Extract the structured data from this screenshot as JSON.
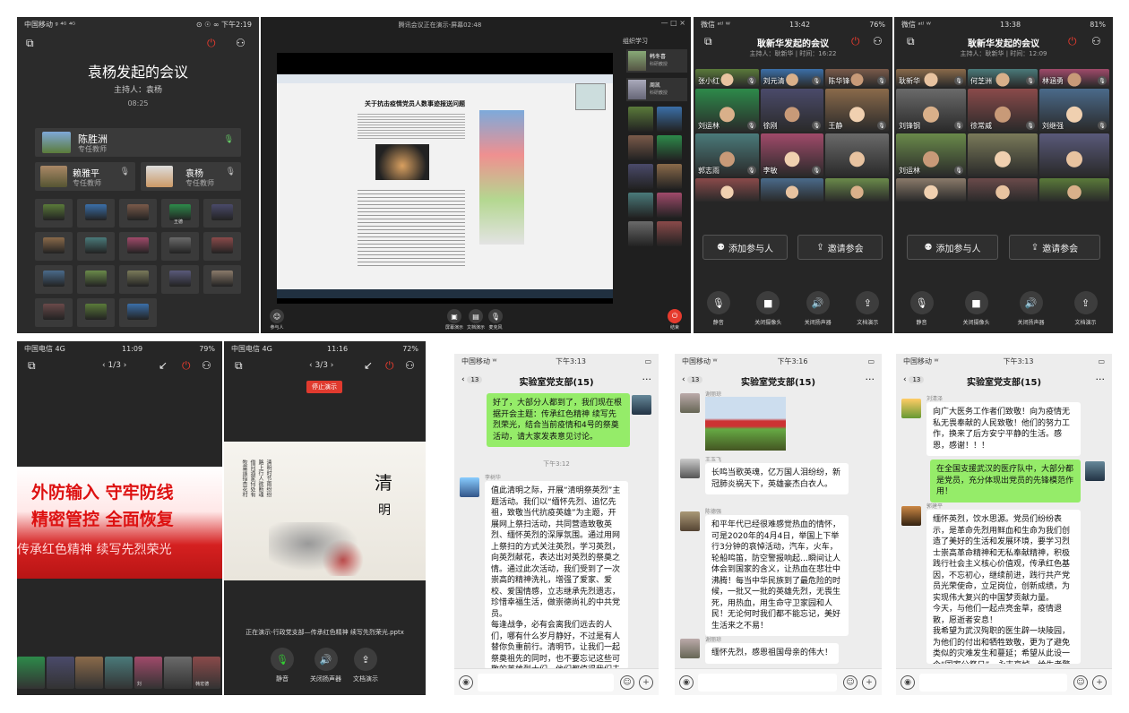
{
  "p1": {
    "status_left": "中国移动 ᵍ ⁴ᴳ ⁴ᴳ",
    "status_right": "⊙ ☉ ∞ 下午2:19",
    "title": "袁杨发起的会议",
    "host": "主持人：袁杨",
    "time": "08:25",
    "speakers": [
      {
        "name": "陈胜洲",
        "role": "专任教师"
      },
      {
        "name": "赖雅平",
        "role": "专任教师"
      },
      {
        "name": "袁杨",
        "role": "专任教师"
      }
    ],
    "grid_labels": [
      "",
      "",
      "",
      "王德",
      "",
      "",
      "",
      "",
      "",
      "",
      "",
      "",
      "",
      "",
      "",
      "",
      "",
      "",
      "",
      ""
    ]
  },
  "p2": {
    "title": "腾讯会议正在演示-屏幕02:48",
    "win_ctrls": "—  □  ×",
    "side_header": "组织学习",
    "side_users": [
      {
        "name": "韩冬喜",
        "role": "科研教授"
      },
      {
        "name": "周凯",
        "role": "科研教授"
      }
    ],
    "doc_title": "关于抗击疫情党员人数事迹报送问题",
    "bottom": [
      {
        "label": "参与人"
      },
      {
        "label": "屏幕演示"
      },
      {
        "label": "文档演示"
      },
      {
        "label": "麦克风"
      },
      {
        "label": "结束"
      }
    ]
  },
  "p3": {
    "status_left": "微信 ᵃᵗˡ ᵂ",
    "status_time": "13:42",
    "status_right": "76%",
    "title": "耿新华发起的会议",
    "sub": "主持人：耿新华 | 时间：16:22",
    "names": [
      "张小红",
      "刘元清",
      "陈华锋",
      "刘运林",
      "徐刚",
      "王静",
      "郭志雨",
      "李敏"
    ],
    "add": "添加参与人",
    "invite": "邀请参会",
    "tools": [
      "静音",
      "关闭摄像头",
      "关闭扬声器",
      "文档演示"
    ]
  },
  "p4": {
    "status_left": "微信 ᵃᵗˡ ᵂ",
    "status_time": "13:38",
    "status_right": "81%",
    "title": "耿新华发起的会议",
    "sub": "主持人：耿新华 | 时间：12:09",
    "names": [
      "耿新华",
      "何芝洲",
      "林涵勇",
      "刘锋钢",
      "徐常威",
      "刘继强",
      "刘运林"
    ],
    "add": "添加参与人",
    "invite": "邀请参会",
    "tools": [
      "静音",
      "关闭摄像头",
      "关闭扬声器",
      "文档演示"
    ]
  },
  "p5": {
    "status_left": "中国电信 4G",
    "status_time": "11:09",
    "status_right": "79%",
    "page": "‹ 1/3 ›",
    "banner1": "外防输入 守牢防线",
    "banner2": "精密管控 全面恢复",
    "banner3": "传承红色精神 续写先烈荣光",
    "thumb_labels": [
      "",
      "",
      "",
      "",
      "刘",
      "",
      "韩宏德"
    ]
  },
  "p6": {
    "status_left": "中国电信 4G",
    "status_time": "11:16",
    "status_right": "72%",
    "page": "‹ 3/3 ›",
    "stop": "停止演示",
    "qm1": "清",
    "qm2": "明",
    "poem": "清明时节雨纷纷\n路上行人欲断魂\n借问酒家何处有\n牧童遥指杏花村",
    "footer": "正在演示-行政党支部—传承红色精神 续写先烈荣光.pptx",
    "tools": [
      "静音",
      "关闭扬声器",
      "文档演示"
    ]
  },
  "p7": {
    "status_left": "中国移动 ᵂ",
    "status_time": "下午3:13",
    "group": "实验室党支部(15)",
    "back": "13",
    "msg1": "好了，大部分人都到了，我们现在根据开会主题：传承红色精神 续写先烈荣光，结合当前疫情和4号的祭奠活动，请大家发表意见讨论。",
    "time": "下午3:12",
    "name2": "李树华",
    "msg2": "值此清明之际，开展“清明祭英烈”主题活动。我们以“缅怀先烈、追忆先祖，致敬当代抗疫英雄”为主题，开展网上祭扫活动，共同营造致敬英烈、缅怀英烈的深厚氛围。通过用网上祭扫的方式关注英烈，学习英烈，向英烈献花，表达出对英烈的祭奠之情。通过此次活动，我们受到了一次崇高的精神洗礼，增强了爱家、爱校、爱国情感，立志继承先烈遗志，珍惜幸福生活，做崇德尚礼的中共党员。\n    每逢战争，必有会离我们远去的人们，哪有什么岁月静好，不过是有人替你负重前行。清明节，让我们一起祭奠祖先的同时，也不要忘记这些可敬的英雄烈士们，他们都值得我们去祭奠，去怀念。抗疫英烈是指引我们前行的灯塔，抗疫"
  },
  "p8": {
    "status_left": "中国移动 ᵂ",
    "status_time": "下午3:16",
    "group": "实验室党支部(15)",
    "back": "13",
    "name1": "谢丽琼",
    "name2": "王玉飞",
    "msg2": "长鸣当歌英魂，亿万国人泪纷纷，新冠肺炎祸天下，英雄豪杰白衣人。",
    "name3": "陈德强",
    "msg3": "和平年代已经很难感觉热血的情怀，可是2020年的4月4日，举国上下举行3分钟的哀悼活动，汽车，火车，轮船鸣笛，防空警报响起…瞬间让人体会到国家的含义，让热血在悲壮中沸腾！每当中华民族到了最危险的时候，一批又一批的英雄先烈，无畏生死，用热血，用生命守卫家园和人民！无论何时我们都不能忘记，美好生活来之不易！",
    "name4": "谢丽琼",
    "msg4": "缅怀先烈，感恩祖国母亲的伟大！"
  },
  "p9": {
    "status_left": "中国移动 ᵂ",
    "status_time": "下午3:13",
    "group": "实验室党支部(15)",
    "back": "13",
    "name1": "刘清泽",
    "msg1": "向广大医务工作者们致敬！向为疫情无私无畏奉献的人民致敬！他们的努力工作，换来了后方安宁平静的生活。感恩，感谢！！！",
    "msg2": "在全国支援武汉的医疗队中，大部分都是党员，充分体现出党员的先锋模范作用！",
    "name3": "郭建平",
    "msg3": "缅怀英烈，饮水思源。党员们纷纷表示，是革命先烈用鲜血和生命为我们创造了美好的生活和发展环境，要学习烈士崇高革命精神和无私奉献精神，积极践行社会主义核心价值观，传承红色基因，不忘初心，继续前进，践行共产党员光荣使命，立足岗位，创新成绩，为实现伟大复兴的中国梦贡献力量。\n今天，与他们一起点亮金草，疫情退散，愿逝者安息！\n我希望为武汉殉职的医生辟一块陵园，为他们的付出和牺牲致敬，更为了避免类似的灾难发生和蔓延；希望从此设一个“国家公祭日”，永志哀悼，给生者警示。"
  }
}
